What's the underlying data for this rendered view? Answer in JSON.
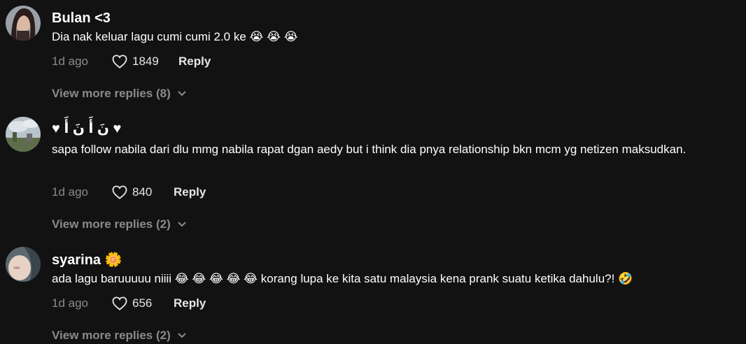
{
  "comments": [
    {
      "username": "Bulan <3",
      "text": "Dia nak keluar lagu cumi cumi 2.0 ke 😭 😭 😭",
      "time": "1d ago",
      "likes": "1849",
      "reply_label": "Reply",
      "view_more": "View more replies (8)"
    },
    {
      "username": "♥ نَ أَ نَ أَ ♥",
      "text": "sapa follow nabila dari dlu mmg nabila rapat dgan aedy but i think dia pnya relationship bkn mcm yg netizen maksudkan.",
      "time": "1d ago",
      "likes": "840",
      "reply_label": "Reply",
      "view_more": "View more replies (2)"
    },
    {
      "username": "syarina 🌼",
      "text": "ada lagu baruuuuu niiii 😂 😂 😂 😂 😂  korang lupa ke kita satu malaysia kena prank suatu ketika dahulu?! 🤣",
      "time": "1d ago",
      "likes": "656",
      "reply_label": "Reply",
      "view_more": "View more replies (2)"
    }
  ],
  "icons": {
    "like": "heart-outline-icon",
    "expand": "chevron-down-icon"
  },
  "colors": {
    "background": "#121212",
    "text_primary": "#ffffff",
    "text_secondary": "#8a8a8a"
  }
}
